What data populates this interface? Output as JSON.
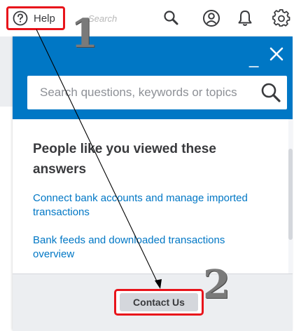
{
  "toolbar": {
    "help_label": "Help",
    "search_placeholder": "Search",
    "icons": [
      "search-icon",
      "user-icon",
      "bell-icon",
      "gear-icon"
    ]
  },
  "panel": {
    "header_color": "#0077c5",
    "minimize_symbol": "_",
    "search_placeholder": "Search questions, keywords or topics",
    "heading": "People like you viewed these answers",
    "links": [
      "Connect bank accounts and manage imported transactions",
      "Bank feeds and downloaded transactions overview"
    ],
    "contact_label": "Contact Us"
  },
  "annotations": {
    "step1": "1",
    "step2": "2",
    "highlight_color": "#e8141b"
  }
}
